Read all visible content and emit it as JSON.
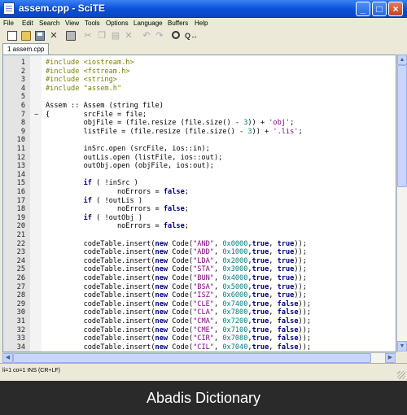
{
  "window": {
    "title": "assem.cpp - SciTE"
  },
  "menu": [
    "File",
    "Edit",
    "Search",
    "View",
    "Tools",
    "Options",
    "Language",
    "Buffers",
    "Help"
  ],
  "toolbar": {
    "icons": [
      "new-file-icon",
      "open-folder-icon",
      "save-icon",
      "close-file-icon",
      "print-icon",
      "cut-icon",
      "copy-icon",
      "paste-icon",
      "delete-icon",
      "undo-icon",
      "redo-icon",
      "find-icon",
      "replace-icon"
    ]
  },
  "tab": {
    "label": "1 assem.cpp"
  },
  "editor": {
    "lines": [
      {
        "n": "1",
        "fold": "",
        "code": "#include <iostream.h>"
      },
      {
        "n": "2",
        "fold": "",
        "code": "#include <fstream.h>"
      },
      {
        "n": "3",
        "fold": "",
        "code": "#include <string>"
      },
      {
        "n": "4",
        "fold": "",
        "code": "#include \"assem.h\""
      },
      {
        "n": "5",
        "fold": "",
        "code": ""
      },
      {
        "n": "6",
        "fold": "",
        "code": "Assem :: Assem (string file)"
      },
      {
        "n": "7",
        "fold": "−",
        "code": "{        srcFile = file;"
      },
      {
        "n": "8",
        "fold": "",
        "code": "         objFile = (file.resize (file.size() - 3)) + 'obj';"
      },
      {
        "n": "9",
        "fold": "",
        "code": "         listFile = (file.resize (file.size() - 3)) + '.lis';"
      },
      {
        "n": "10",
        "fold": "",
        "code": ""
      },
      {
        "n": "11",
        "fold": "",
        "code": "         inSrc.open (srcFile, ios::in);"
      },
      {
        "n": "12",
        "fold": "",
        "code": "         outLis.open (listFile, ios::out);"
      },
      {
        "n": "13",
        "fold": "",
        "code": "         outObj.open (objFile, ios:out);"
      },
      {
        "n": "14",
        "fold": "",
        "code": ""
      },
      {
        "n": "15",
        "fold": "",
        "code": "         if ( !inSrc )"
      },
      {
        "n": "16",
        "fold": "",
        "code": "                 noErrors = false;"
      },
      {
        "n": "17",
        "fold": "",
        "code": "         if ( !outLis )"
      },
      {
        "n": "18",
        "fold": "",
        "code": "                 noErrors = false;"
      },
      {
        "n": "19",
        "fold": "",
        "code": "         if ( !outObj )"
      },
      {
        "n": "20",
        "fold": "",
        "code": "                 noErrors = false;"
      },
      {
        "n": "21",
        "fold": "",
        "code": ""
      },
      {
        "n": "22",
        "fold": "",
        "code": "         codeTable.insert(new Code(\"AND\", 0x0000,true, true));"
      },
      {
        "n": "23",
        "fold": "",
        "code": "         codeTable.insert(new Code(\"ADD\", 0x1000,true, true));"
      },
      {
        "n": "24",
        "fold": "",
        "code": "         codeTable.insert(new Code(\"LDA\", 0x2000,true, true));"
      },
      {
        "n": "25",
        "fold": "",
        "code": "         codeTable.insert(new Code(\"STA\", 0x3000,true, true));"
      },
      {
        "n": "26",
        "fold": "",
        "code": "         codeTable.insert(new Code(\"BUN\", 0x4000,true, true));"
      },
      {
        "n": "27",
        "fold": "",
        "code": "         codeTable.insert(new Code(\"BSA\", 0x5000,true, true));"
      },
      {
        "n": "28",
        "fold": "",
        "code": "         codeTable.insert(new Code(\"ISZ\", 0x6000,true, true));"
      },
      {
        "n": "29",
        "fold": "",
        "code": "         codeTable.insert(new Code(\"CLE\", 0x7400,true, false));"
      },
      {
        "n": "30",
        "fold": "",
        "code": "         codeTable.insert(new Code(\"CLA\", 0x7800,true, false));"
      },
      {
        "n": "31",
        "fold": "",
        "code": "         codeTable.insert(new Code(\"CMA\", 0x7200,true, false));"
      },
      {
        "n": "32",
        "fold": "",
        "code": "         codeTable.insert(new Code(\"CME\", 0x7100,true, false));"
      },
      {
        "n": "33",
        "fold": "",
        "code": "         codeTable.insert(new Code(\"CIR\", 0x7080,true, false));"
      },
      {
        "n": "34",
        "fold": "",
        "code": "         codeTable.insert(new Code(\"CIL\", 0x7040,true, false));"
      }
    ]
  },
  "status": {
    "text": "li=1 co=1 INS (CR+LF)"
  },
  "caption": {
    "text": "Abadis Dictionary"
  },
  "colors": {
    "preprocessor": "#7f7f00",
    "keyword": "#00007f",
    "string": "#7f007f",
    "number": "#007f7f",
    "titlebar": "#0a4fd8"
  }
}
